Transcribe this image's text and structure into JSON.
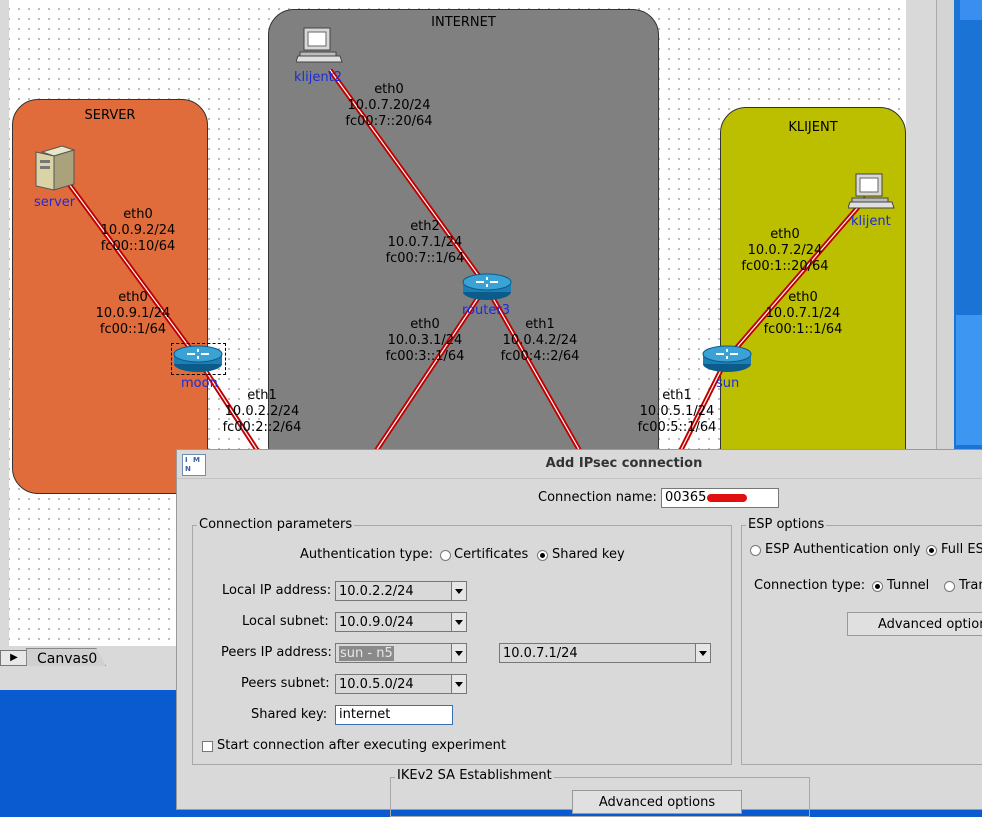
{
  "canvas": {
    "zones": {
      "server": "SERVER",
      "internet": "INTERNET",
      "klijent": "KLIJENT"
    },
    "nodes": {
      "server": "server",
      "moon": "moon",
      "router3": "router3",
      "sun": "sun",
      "klijent": "klijent",
      "klijent2": "klijent2"
    },
    "links": {
      "server_if": [
        "eth0",
        "10.0.9.2/24",
        "fc00::10/64"
      ],
      "moon_eth0": [
        "eth0",
        "10.0.9.1/24",
        "fc00::1/64"
      ],
      "moon_eth1": [
        "eth1",
        "10.0.2.2/24",
        "fc00:2::2/64"
      ],
      "klijent2_eth0": [
        "eth0",
        "10.0.7.20/24",
        "fc00:7::20/64"
      ],
      "router3_eth2": [
        "eth2",
        "10.0.7.1/24",
        "fc00:7::1/64"
      ],
      "router3_eth0": [
        "eth0",
        "10.0.3.1/24",
        "fc00:3::1/64"
      ],
      "router3_eth1": [
        "eth1",
        "10.0.4.2/24",
        "fc00:4::2/64"
      ],
      "sun_eth1": [
        "eth1",
        "10.0.5.1/24",
        "fc00:5::1/64"
      ],
      "klijent_eth0": [
        "eth0",
        "10.0.7.2/24",
        "fc00:1::20/64"
      ],
      "sun_eth0": [
        "eth0",
        "10.0.7.1/24",
        "fc00:1::1/64"
      ]
    },
    "tab_label": "Canvas0",
    "scroll_arrow": "▶"
  },
  "dialog": {
    "title": "Add IPsec connection",
    "icon_text": "I M N",
    "connection_name_label": "Connection name:",
    "connection_name_value": "00365",
    "connection_params": {
      "title": "Connection parameters",
      "auth_type_label": "Authentication type:",
      "auth_certificates": "Certificates",
      "auth_shared_key": "Shared key",
      "local_ip_label": "Local IP address:",
      "local_ip_value": "10.0.2.2/24",
      "local_subnet_label": "Local subnet:",
      "local_subnet_value": "10.0.9.0/24",
      "peers_ip_label": "Peers IP address:",
      "peers_ip_node": "sun - n5",
      "peers_ip_value": "10.0.7.1/24",
      "peers_subnet_label": "Peers subnet:",
      "peers_subnet_value": "10.0.5.0/24",
      "shared_key_label": "Shared key:",
      "shared_key_value": "internet",
      "start_conn_label": "Start connection after executing experiment"
    },
    "esp": {
      "title": "ESP options",
      "auth_only": "ESP Authentication only",
      "full": "Full ES",
      "conn_type_label": "Connection type:",
      "tunnel": "Tunnel",
      "transport": "Tran",
      "advanced": "Advanced options"
    },
    "ikev2": {
      "title": "IKEv2 SA Establishment",
      "advanced": "Advanced options"
    }
  }
}
